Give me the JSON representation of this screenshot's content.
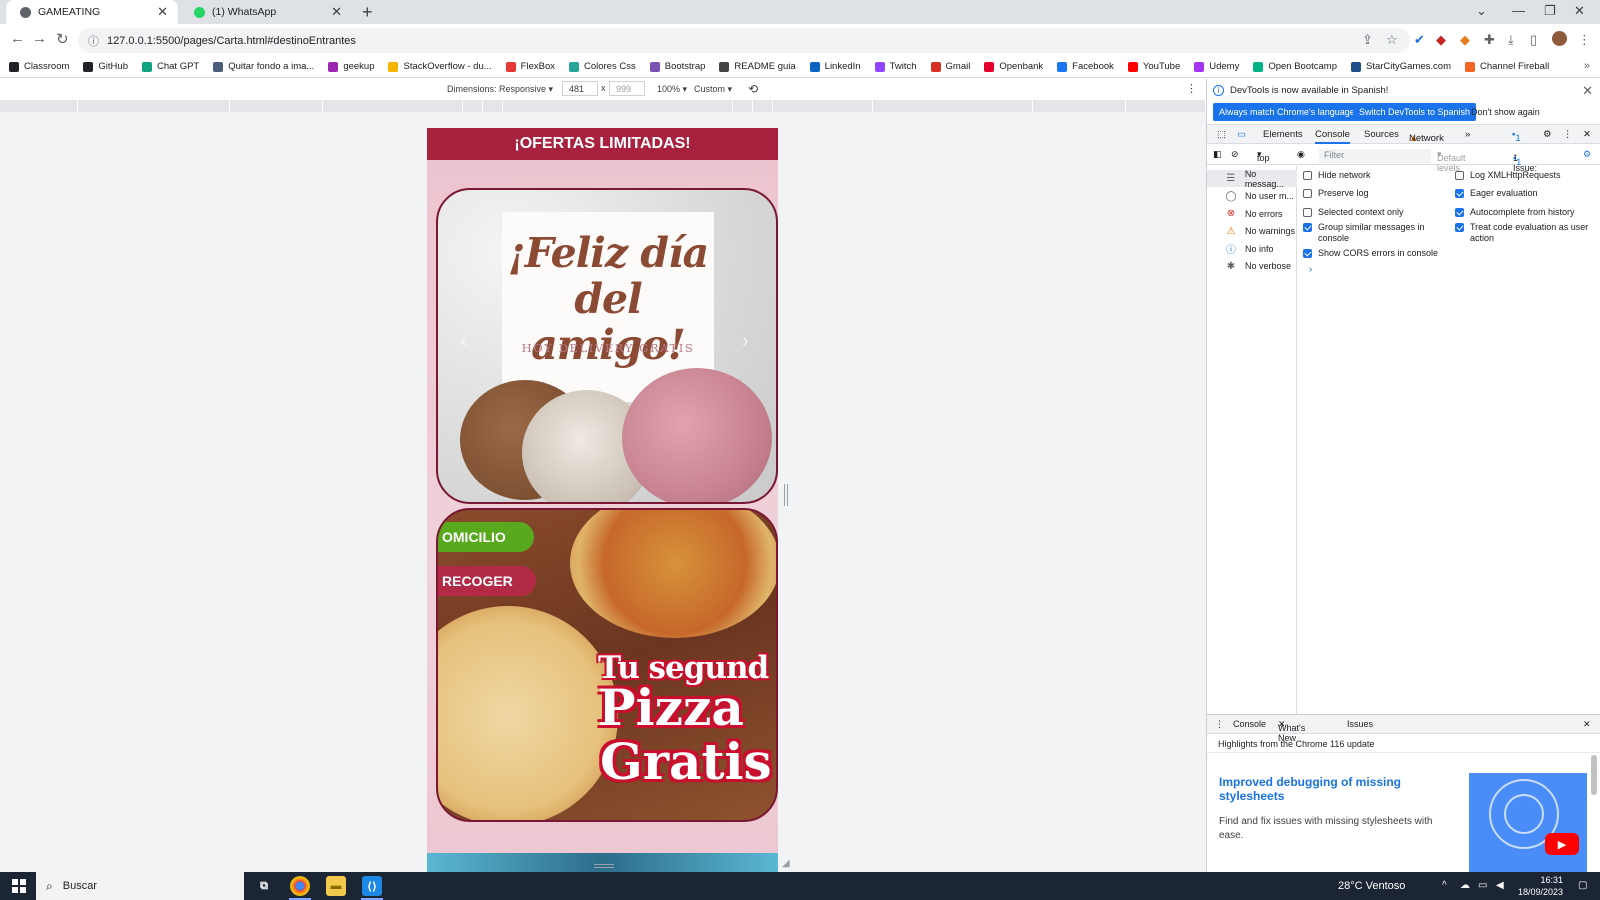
{
  "browser": {
    "tabs": [
      {
        "title": "GAMEATING",
        "active": true,
        "favicon": "web-favicon"
      },
      {
        "title": "(1) WhatsApp",
        "active": false,
        "favicon": "whatsapp-favicon"
      }
    ],
    "url": "127.0.0.1:5500/pages/Carta.html#destinoEntrantes"
  },
  "bookmarks": [
    {
      "label": "Classroom",
      "color": "#202124"
    },
    {
      "label": "GitHub",
      "color": "#202124"
    },
    {
      "label": "Chat GPT",
      "color": "#10a37f"
    },
    {
      "label": "Quitar fondo a ima...",
      "color": "#4a5d7a"
    },
    {
      "label": "geekup",
      "color": "#9c27b0"
    },
    {
      "label": "StackOverflow - du...",
      "color": "#f4b400"
    },
    {
      "label": "FlexBox",
      "color": "#e53935"
    },
    {
      "label": "Colores Css",
      "color": "#26a69a"
    },
    {
      "label": "Bootstrap",
      "color": "#7952b3"
    },
    {
      "label": "README guia",
      "color": "#444444"
    },
    {
      "label": "LinkedIn",
      "color": "#0a66c2"
    },
    {
      "label": "Twitch",
      "color": "#9146ff"
    },
    {
      "label": "Gmail",
      "color": "#d93025"
    },
    {
      "label": "Openbank",
      "color": "#e4002b"
    },
    {
      "label": "Facebook",
      "color": "#1877f2"
    },
    {
      "label": "YouTube",
      "color": "#ff0000"
    },
    {
      "label": "Udemy",
      "color": "#a435f0"
    },
    {
      "label": "Open Bootcamp",
      "color": "#00b386"
    },
    {
      "label": "StarCityGames.com",
      "color": "#1d4e89"
    },
    {
      "label": "Channel Fireball",
      "color": "#f26522"
    }
  ],
  "device_toolbar": {
    "dimensions_label": "Dimensions: Responsive",
    "width": "481",
    "height_placeholder": "999",
    "times": "x",
    "zoom": "100%",
    "throttle": "Custom"
  },
  "page": {
    "banner": "¡OFERTAS LIMITADAS!",
    "card1_headline_1": "¡Feliz día",
    "card1_headline_2": "del amigo!",
    "card1_subline": "HOY DELIVERY GRATIS",
    "pill_delivery": "OMICILIO",
    "pill_pickup": "RECOGER",
    "promo_line1": "Tu segund",
    "promo_line2": "Pizza",
    "promo_line3": "Gratis"
  },
  "devtools": {
    "lang_notice": "DevTools is now available in Spanish!",
    "btn_match": "Always match Chrome's language",
    "btn_switch": "Switch DevTools to Spanish",
    "btn_dont_show": "Don't show again",
    "tabs": {
      "elements": "Elements",
      "console": "Console",
      "sources": "Sources",
      "network": "Network",
      "issues_count": "1"
    },
    "context": "top",
    "filter_placeholder": "Filter",
    "levels": "Default levels",
    "issues_label": "1 Issue:",
    "issues_num": "1",
    "sidebar": [
      {
        "label": "No messag...",
        "icon": "list-icon"
      },
      {
        "label": "No user m...",
        "icon": "user-icon"
      },
      {
        "label": "No errors",
        "icon": "error-icon"
      },
      {
        "label": "No warnings",
        "icon": "warning-icon"
      },
      {
        "label": "No info",
        "icon": "info-icon"
      },
      {
        "label": "No verbose",
        "icon": "bug-icon"
      }
    ],
    "settings_left": [
      {
        "label": "Hide network",
        "checked": false
      },
      {
        "label": "Preserve log",
        "checked": false
      },
      {
        "label": "Selected context only",
        "checked": false
      },
      {
        "label": "Group similar messages in console",
        "checked": true
      },
      {
        "label": "Show CORS errors in console",
        "checked": true
      }
    ],
    "settings_right": [
      {
        "label": "Log XMLHttpRequests",
        "checked": false
      },
      {
        "label": "Eager evaluation",
        "checked": true
      },
      {
        "label": "Autocomplete from history",
        "checked": true
      },
      {
        "label": "Treat code evaluation as user action",
        "checked": true
      }
    ],
    "drawer_tabs": {
      "console": "Console",
      "whats_new": "What's New",
      "issues": "Issues"
    },
    "highlights": "Highlights from the Chrome 116 update",
    "whats_new_title": "Improved debugging of missing stylesheets",
    "whats_new_desc": "Find and fix issues with missing stylesheets with ease."
  },
  "taskbar": {
    "search_label": "Buscar",
    "weather": "28°C  Ventoso",
    "time": "16:31",
    "date": "18/09/2023"
  }
}
